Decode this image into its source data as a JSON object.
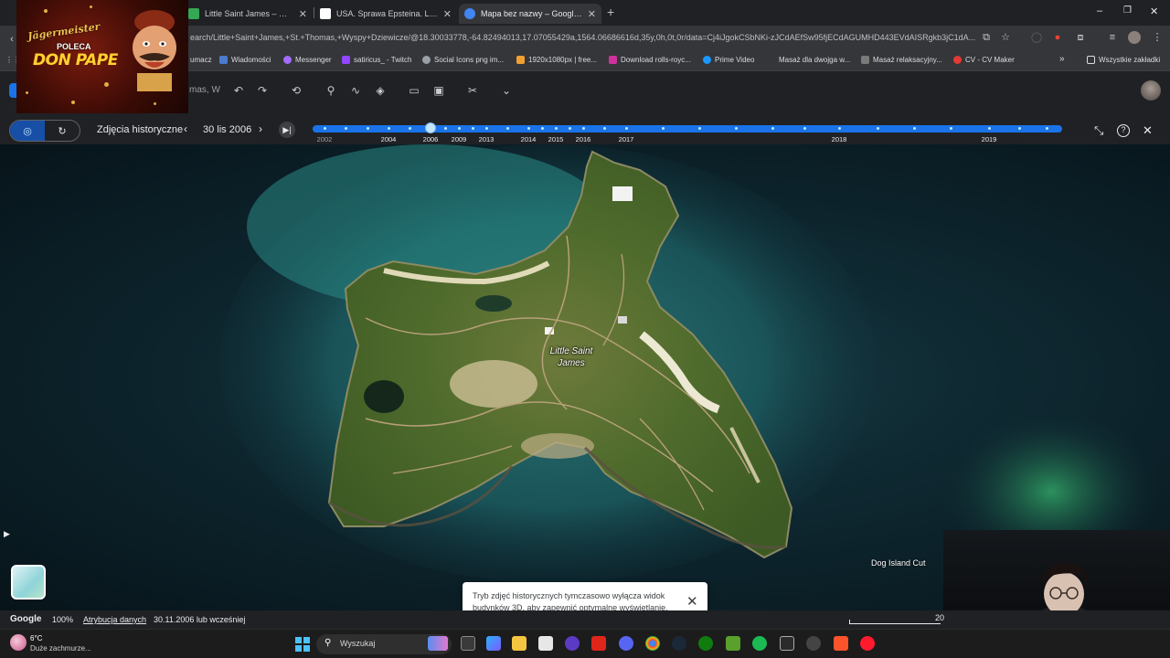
{
  "browser": {
    "tabs": [
      {
        "label": "Little Saint James – Mapy Goog",
        "active": false,
        "favicon_color": "#34a853"
      },
      {
        "label": "USA. Sprawa Epsteina. Lista naz",
        "active": false,
        "favicon_color": "#ffffff"
      },
      {
        "label": "Mapa bez nazwy – Google Earth",
        "active": true,
        "favicon_color": "#4285f4"
      }
    ],
    "url": "earch/Little+Saint+James,+St.+Thomas,+Wyspy+Dziewicze/@18.30033778,-64.82494013,17.07055429a,1564.06686616d,35y,0h,0t,0r/data=Cj4iJgokCSbNKi-zJCdAEfSw95fjECdAGUMHD443EVdAISRgkb3jC1dA...",
    "bookmarks": [
      {
        "label": "umacz",
        "color": "#4285f4"
      },
      {
        "label": "Wiadomości",
        "color": "#4a7bd0"
      },
      {
        "label": "Messenger",
        "color": "#a36bff"
      },
      {
        "label": "satiricus_ - Twitch",
        "color": "#9146ff"
      },
      {
        "label": "Social Icons png im...",
        "color": "#9aa0a6"
      },
      {
        "label": "1920x1080px | free...",
        "color": "#f0a030"
      },
      {
        "label": "Download rolls-royc...",
        "color": "#d0309f"
      },
      {
        "label": "Prime Video",
        "color": "#1a98ff"
      },
      {
        "label": "Masaż dla dwojga w...",
        "color": "#7a7a7a"
      },
      {
        "label": "Masaż relaksacyjny...",
        "color": "#7a7a7a"
      },
      {
        "label": "CV - CV Maker",
        "color": "#e53935"
      }
    ],
    "bookmarks_more": "»",
    "all_bookmarks": "Wszystkie zakładki",
    "window_controls": [
      "–",
      "❐",
      "✕"
    ]
  },
  "promo": {
    "brand": "Jägermeister",
    "poleca": "POLECA",
    "name": "DON PAPE"
  },
  "earth": {
    "search_value": "mas, W",
    "historical": {
      "label": "Zdjęcia historyczne",
      "date": "30 lis 2006",
      "timeline_years": [
        "2002",
        "2004",
        "2006",
        "2009",
        "2013",
        "2014",
        "2015",
        "2016",
        "2017",
        "2018",
        "2019"
      ],
      "selected_year": "2006"
    },
    "map_labels": {
      "island": "Little Saint James",
      "dog_island": "Dog Island Cut"
    },
    "toast": {
      "text": "Tryb zdjęć historycznych tymczasowo wyłącza widok budynków 3D, aby zapewnić optymalne wyświetlanie."
    },
    "status": {
      "logo": "Google",
      "zoom": "100%",
      "attribution": "Atrybucja danych",
      "image_date": "30.11.2006 lub wcześniej",
      "scale": "20"
    }
  },
  "taskbar": {
    "weather_temp": "6°C",
    "weather_desc": "Duże zachmurze...",
    "search_label": "Wyszukaj"
  },
  "colors": {
    "accent": "#1a73e8",
    "timeline": "#1a73e8",
    "chrome_dark": "#202124",
    "ocean": "#0f2a33"
  }
}
